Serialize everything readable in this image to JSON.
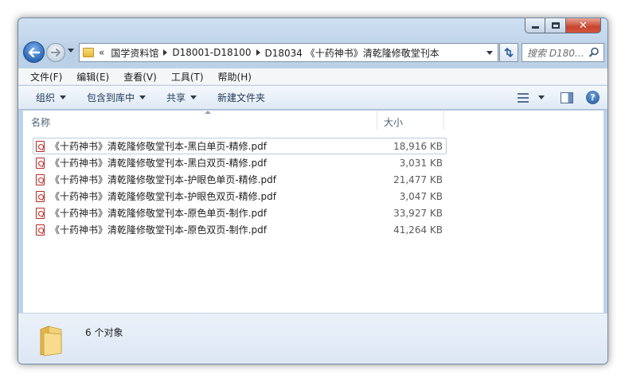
{
  "address": {
    "chevron": "«",
    "crumbs": [
      "国学资料馆",
      "D18001-D18100",
      "D18034 《十药神书》清乾隆修敬堂刊本"
    ]
  },
  "search": {
    "placeholder": "搜索 D180..."
  },
  "menu": [
    "文件(F)",
    "编辑(E)",
    "查看(V)",
    "工具(T)",
    "帮助(H)"
  ],
  "commands": {
    "organize": "组织",
    "include_in_library": "包含到库中",
    "share": "共享",
    "new_folder": "新建文件夹"
  },
  "columns": {
    "name": "名称",
    "size": "大小"
  },
  "files": [
    {
      "name": "《十药神书》清乾隆修敬堂刊本-黑白单页-精修.pdf",
      "size": "18,916 KB"
    },
    {
      "name": "《十药神书》清乾隆修敬堂刊本-黑白双页-精修.pdf",
      "size": "3,031 KB"
    },
    {
      "name": "《十药神书》清乾隆修敬堂刊本-护眼色单页-精修.pdf",
      "size": "21,477 KB"
    },
    {
      "name": "《十药神书》清乾隆修敬堂刊本-护眼色双页-精修.pdf",
      "size": "3,047 KB"
    },
    {
      "name": "《十药神书》清乾隆修敬堂刊本-原色单页-制作.pdf",
      "size": "33,927 KB"
    },
    {
      "name": "《十药神书》清乾隆修敬堂刊本-原色双页-制作.pdf",
      "size": "41,264 KB"
    }
  ],
  "status": {
    "item_count": "6 个对象"
  },
  "icons": {
    "back": "back-arrow-icon",
    "forward": "forward-arrow-icon",
    "refresh": "refresh-icon",
    "search": "search-icon",
    "file": "pdf-file-icon",
    "folder": "folder-icon"
  },
  "colors": {
    "accent": "#2a67b5",
    "close": "#c7452f"
  }
}
